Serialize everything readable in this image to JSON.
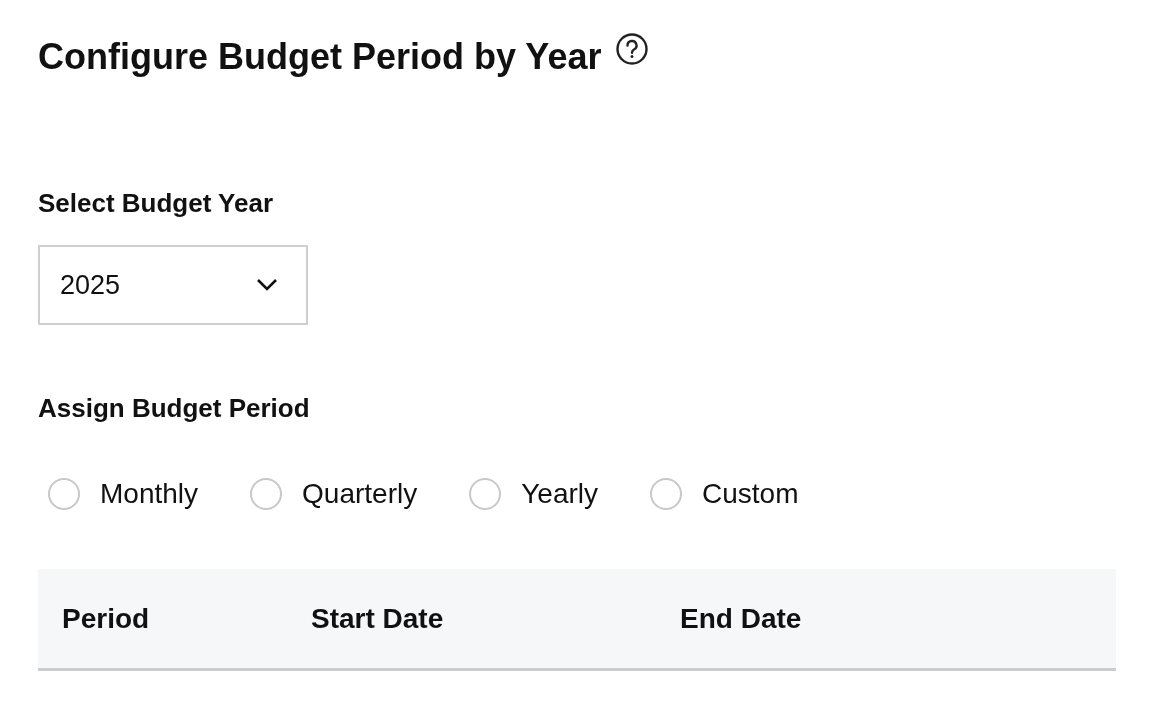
{
  "title": "Configure Budget Period by Year",
  "year_select": {
    "label": "Select Budget Year",
    "value": "2025"
  },
  "period_group": {
    "label": "Assign Budget Period",
    "options": [
      {
        "label": "Monthly",
        "selected": false
      },
      {
        "label": "Quarterly",
        "selected": false
      },
      {
        "label": "Yearly",
        "selected": false
      },
      {
        "label": "Custom",
        "selected": false
      }
    ]
  },
  "table": {
    "columns": [
      "Period",
      "Start Date",
      "End Date"
    ]
  }
}
